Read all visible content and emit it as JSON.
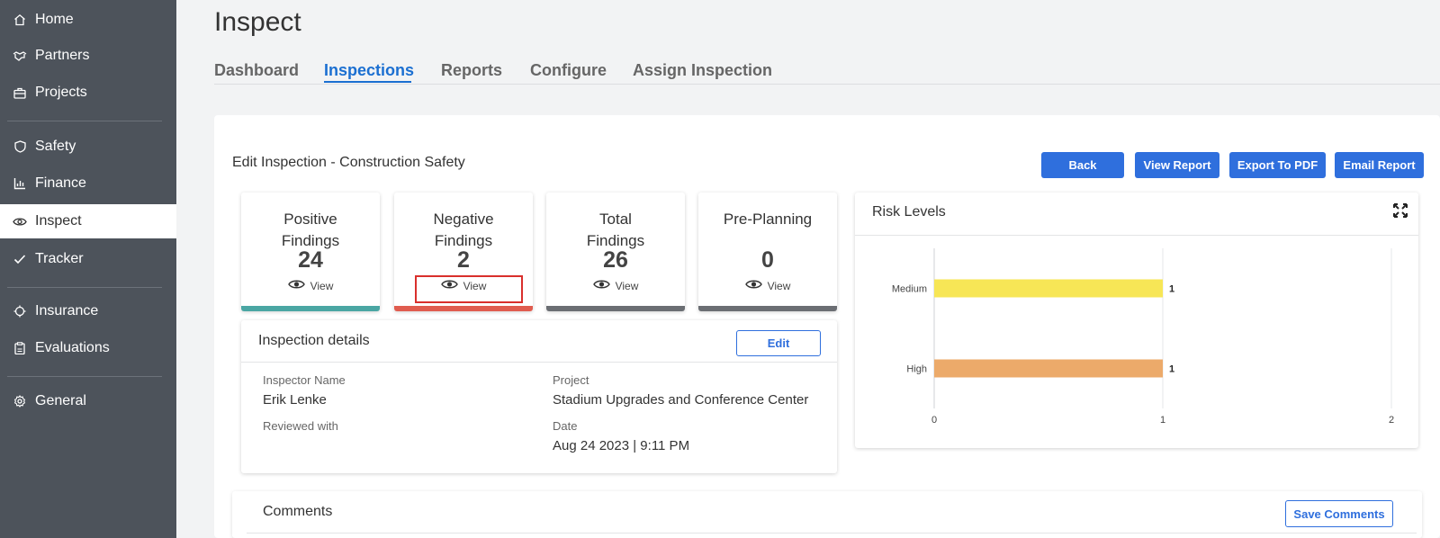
{
  "sidebar": {
    "items": [
      {
        "label": "Home",
        "icon": "home-icon"
      },
      {
        "label": "Partners",
        "icon": "handshake-icon"
      },
      {
        "label": "Projects",
        "icon": "briefcase-icon"
      },
      {
        "label": "Safety",
        "icon": "shield-icon"
      },
      {
        "label": "Finance",
        "icon": "bar-chart-icon"
      },
      {
        "label": "Inspect",
        "icon": "eye-icon",
        "active": true
      },
      {
        "label": "Tracker",
        "icon": "check-icon"
      },
      {
        "label": "Insurance",
        "icon": "gear-ring-icon"
      },
      {
        "label": "Evaluations",
        "icon": "clipboard-icon"
      },
      {
        "label": "General",
        "icon": "settings-icon"
      }
    ]
  },
  "header": {
    "title": "Inspect",
    "tabs": [
      {
        "label": "Dashboard"
      },
      {
        "label": "Inspections",
        "active": true
      },
      {
        "label": "Reports"
      },
      {
        "label": "Configure"
      },
      {
        "label": "Assign Inspection"
      }
    ]
  },
  "main": {
    "title": "Edit Inspection - Construction Safety",
    "buttons": {
      "back": "Back",
      "view_report": "View Report",
      "export_pdf": "Export To PDF",
      "email_report": "Email Report"
    },
    "stats": [
      {
        "label": "Positive Findings",
        "value": "24",
        "view": "View",
        "color": "#4aa6a3"
      },
      {
        "label": "Negative Findings",
        "value": "2",
        "view": "View",
        "color": "#e05c4f"
      },
      {
        "label": "Total Findings",
        "value": "26",
        "view": "View",
        "color": "#6b6e73"
      },
      {
        "label": "Pre-Planning",
        "value": "0",
        "view": "View",
        "color": "#6b6e73"
      }
    ],
    "details": {
      "title": "Inspection details",
      "edit_label": "Edit",
      "inspector_label": "Inspector Name",
      "inspector_value": "Erik Lenke",
      "reviewed_label": "Reviewed with",
      "project_label": "Project",
      "project_value": "Stadium Upgrades and Conference Center",
      "date_label": "Date",
      "date_value": "Aug 24 2023 | 9:11 PM"
    },
    "risk": {
      "title": "Risk Levels",
      "expand_icon": "expand-icon"
    },
    "comments": {
      "title": "Comments",
      "save_label": "Save Comments"
    }
  },
  "chart_data": {
    "type": "bar",
    "orientation": "horizontal",
    "categories": [
      "Medium",
      "High"
    ],
    "values": [
      1,
      1
    ],
    "colors": [
      "#f7e656",
      "#ecaa6a"
    ],
    "data_labels": [
      "1",
      "1"
    ],
    "x_ticks": [
      "0",
      "1",
      "2"
    ],
    "xlim": [
      0,
      2
    ],
    "grid": true,
    "title": "",
    "xlabel": "",
    "ylabel": ""
  }
}
